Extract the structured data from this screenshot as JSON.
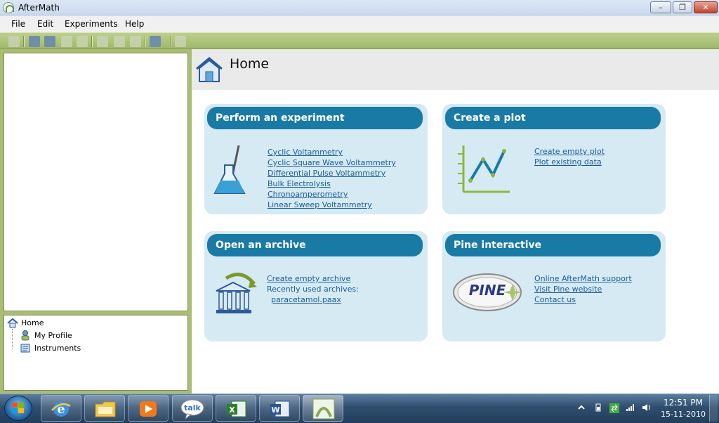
{
  "window": {
    "title": "AfterMath"
  },
  "menu": [
    "File",
    "Edit",
    "Experiments",
    "Help"
  ],
  "tree": {
    "items": [
      "Home",
      "My Profile",
      "Instruments"
    ]
  },
  "page": {
    "title": "Home"
  },
  "cards": {
    "experiment": {
      "title": "Perform an experiment",
      "links": [
        "Cyclic Voltammetry ",
        "Cyclic Square Wave Voltammetry ",
        "Differential Pulse Voltammetry ",
        "Bulk Electrolysis ",
        "Chronoamperometry ",
        "Linear Sweep Voltammetry "
      ]
    },
    "plot": {
      "title": "Create a plot",
      "links": [
        "Create empty plot",
        "Plot existing data"
      ]
    },
    "archive": {
      "title": "Open an archive",
      "create_link": "Create empty archive",
      "recent_label": "Recently used archives:",
      "recent_file": "paracetamol.paax"
    },
    "pine": {
      "title": "Pine interactive",
      "logo_text": "PINE",
      "links": [
        "Online AfterMath support",
        "Visit Pine website",
        "Contact us"
      ]
    }
  },
  "taskbar": {
    "talk_label": "talk",
    "time": "12:51 PM",
    "date": "15-11-2010"
  },
  "colors": {
    "accent": "#1a7aa6",
    "card_bg": "#d6eaf3",
    "toolbar": "#a9bd73",
    "link": "#1a5c9b"
  }
}
